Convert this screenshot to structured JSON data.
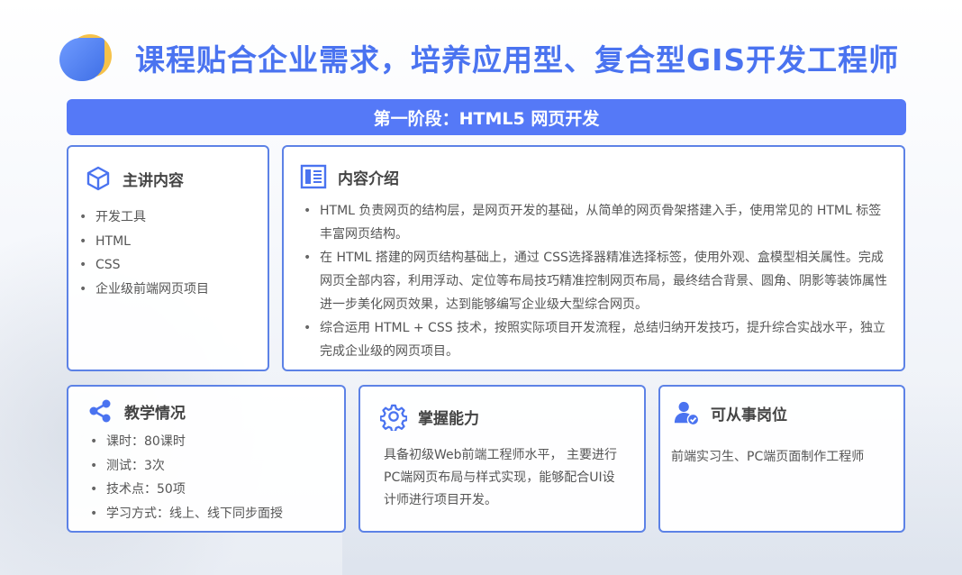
{
  "header": {
    "title": "课程贴合企业需求，培养应用型、复合型GIS开发工程师"
  },
  "stage": {
    "label": "第一阶段：HTML5 网页开发"
  },
  "main_content": {
    "title": "主讲内容",
    "icon": "cube-icon",
    "items": [
      "开发工具",
      "HTML",
      "CSS",
      "企业级前端网页项目"
    ]
  },
  "intro": {
    "title": "内容介绍",
    "icon": "document-icon",
    "items": [
      "HTML 负责网页的结构层，是网页开发的基础，从简单的网页骨架搭建入手，使用常见的 HTML 标签丰富网页结构。",
      "在 HTML 搭建的网页结构基础上，通过 CSS选择器精准选择标签，使用外观、盒模型相关属性。完成网页全部内容，利用浮动、定位等布局技巧精准控制网页布局，最终结合背景、圆角、阴影等装饰属性进一步美化网页效果，达到能够编写企业级大型综合网页。",
      "综合运用 HTML + CSS 技术，按照实际项目开发流程，总结归纳开发技巧，提升综合实战水平，独立完成企业级的网页项目。"
    ]
  },
  "teaching": {
    "title": "教学情况",
    "icon": "share-icon",
    "items": [
      "课时：80课时",
      "测试：3次",
      "技术点：50项",
      "学习方式：线上、线下同步面授"
    ]
  },
  "ability": {
    "title": "掌握能力",
    "icon": "gear-icon",
    "text": "具备初级Web前端工程师水平， 主要进行PC端网页布局与样式实现，能够配合UI设计师进行项目开发。"
  },
  "jobs": {
    "title": "可从事岗位",
    "icon": "user-check-icon",
    "text": "前端实习生、PC端页面制作工程师"
  },
  "colors": {
    "accent": "#5579f7",
    "title": "#4a73f0",
    "border": "#5d82e6",
    "logo_yellow": "#f6c24a"
  }
}
